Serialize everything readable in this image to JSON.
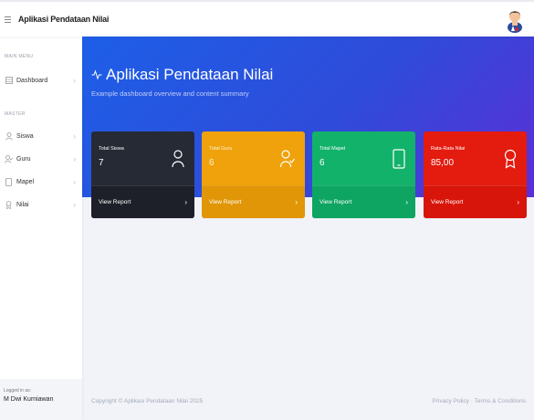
{
  "topbar": {
    "menu_icon": "hamburger-icon",
    "brand": "Aplikasi Pendataan Nilai",
    "avatar_icon": "user-avatar"
  },
  "sidebar": {
    "main_menu_heading": "MAIN MENU",
    "master_heading": "MASTER",
    "items": [
      {
        "label": "Dashboard",
        "icon": "grid-icon"
      },
      {
        "label": "Siswa",
        "icon": "user-icon"
      },
      {
        "label": "Guru",
        "icon": "user-check-icon"
      },
      {
        "label": "Mapel",
        "icon": "book-icon"
      },
      {
        "label": "Nilai",
        "icon": "award-icon"
      }
    ],
    "footer": {
      "logged_in_label": "Logged in as:",
      "user_name": "M Dwi Kurniawan"
    }
  },
  "hero": {
    "title": "Aplikasi Pendataan Nilai",
    "subtitle": "Example dashboard overview and content summary",
    "background_start": "#1d5fe8",
    "background_end": "#5b2fd6"
  },
  "cards": [
    {
      "label": "Total Siswa",
      "value": "7",
      "link": "View Report",
      "color": "#262a35",
      "icon": "user-icon"
    },
    {
      "label": "Total Guru",
      "value": "6",
      "link": "View Report",
      "color": "#efa20b",
      "icon": "user-check-icon"
    },
    {
      "label": "Total Mapel",
      "value": "6",
      "link": "View Report",
      "color": "#13b26a",
      "icon": "tablet-icon"
    },
    {
      "label": "Rata-Rata Nilai",
      "value": "85,00",
      "link": "View Report",
      "color": "#e41b0f",
      "icon": "award-icon"
    }
  ],
  "footer": {
    "copyright": "Copyright © Aplikasi Pendataan Nilai 2025",
    "links": "Privacy Policy · Terms & Conditions"
  }
}
